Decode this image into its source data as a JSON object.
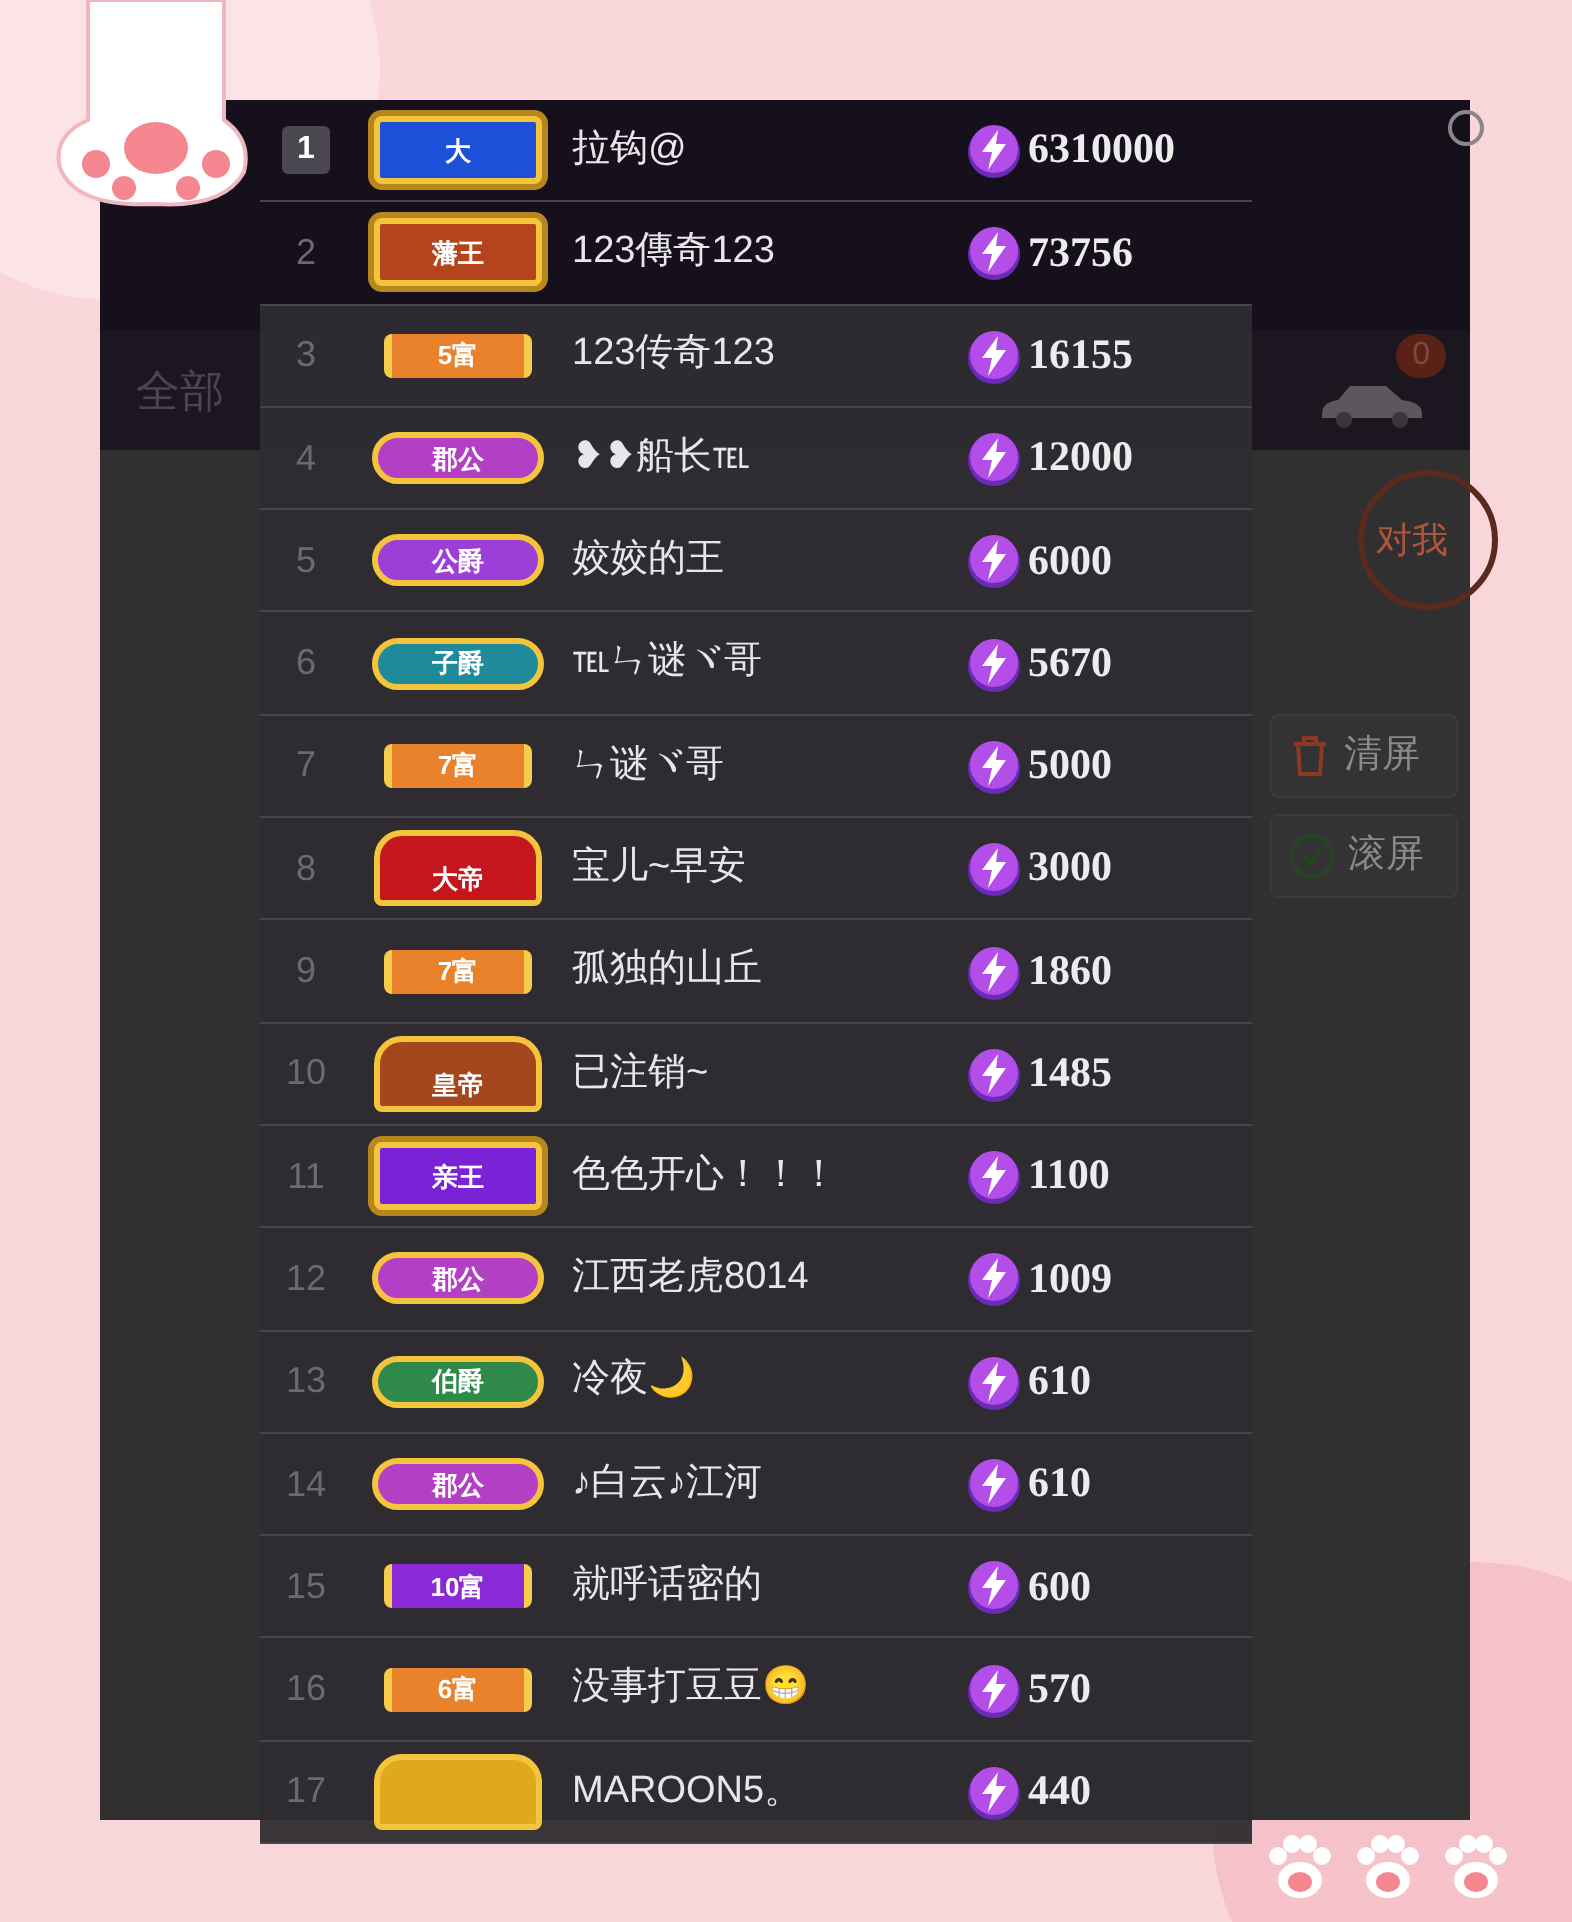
{
  "tabs": [
    {
      "label": "全部"
    }
  ],
  "car_badge": "0",
  "side_bubble": "对我",
  "side_buttons": [
    {
      "kind": "clear",
      "label": "清屏"
    },
    {
      "kind": "scroll",
      "label": "滚屏"
    }
  ],
  "ranking": [
    {
      "rank": "1",
      "boxed": true,
      "badge": {
        "kind": "wing",
        "label": "大",
        "color": "#1d4fd8"
      },
      "name": "拉钩@",
      "score": "6310000"
    },
    {
      "rank": "2",
      "boxed": false,
      "badge": {
        "kind": "wing",
        "label": "藩王",
        "color": "#b5441c"
      },
      "name": "123傳奇123",
      "score": "73756"
    },
    {
      "rank": "3",
      "boxed": false,
      "badge": {
        "kind": "bar",
        "label": "5富",
        "color": "#e9822a"
      },
      "name": "123传奇123",
      "score": "16155"
    },
    {
      "rank": "4",
      "boxed": false,
      "badge": {
        "kind": "hex",
        "label": "郡公",
        "color": "#b23fc4"
      },
      "name": "❥❥船长℡",
      "score": "12000"
    },
    {
      "rank": "5",
      "boxed": false,
      "badge": {
        "kind": "hex",
        "label": "公爵",
        "color": "#9b3fd8"
      },
      "name": "姣姣的王",
      "score": "6000"
    },
    {
      "rank": "6",
      "boxed": false,
      "badge": {
        "kind": "hex",
        "label": "子爵",
        "color": "#1f8a99"
      },
      "name": "℡ㄣ谜ヾ哥",
      "score": "5670"
    },
    {
      "rank": "7",
      "boxed": false,
      "badge": {
        "kind": "bar",
        "label": "7富",
        "color": "#e9822a"
      },
      "name": "ㄣ谜ヾ哥",
      "score": "5000"
    },
    {
      "rank": "8",
      "boxed": false,
      "badge": {
        "kind": "crown",
        "label": "大帝",
        "color": "#c4161c"
      },
      "name": "宝儿~早安",
      "score": "3000"
    },
    {
      "rank": "9",
      "boxed": false,
      "badge": {
        "kind": "bar",
        "label": "7富",
        "color": "#e9822a"
      },
      "name": "孤独的山丘",
      "score": "1860"
    },
    {
      "rank": "10",
      "boxed": false,
      "badge": {
        "kind": "crown",
        "label": "皇帝",
        "color": "#a4461e"
      },
      "name": "已注销~",
      "score": "1485"
    },
    {
      "rank": "11",
      "boxed": false,
      "badge": {
        "kind": "wing",
        "label": "亲王",
        "color": "#7a23d6"
      },
      "name": "色色开心！！！",
      "score": "1100"
    },
    {
      "rank": "12",
      "boxed": false,
      "badge": {
        "kind": "hex",
        "label": "郡公",
        "color": "#b23fc4"
      },
      "name": "江西老虎8014",
      "score": "1009"
    },
    {
      "rank": "13",
      "boxed": false,
      "badge": {
        "kind": "hex",
        "label": "伯爵",
        "color": "#2f8a4a"
      },
      "name": "冷夜🌙",
      "score": "610"
    },
    {
      "rank": "14",
      "boxed": false,
      "badge": {
        "kind": "hex",
        "label": "郡公",
        "color": "#b23fc4"
      },
      "name": "♪白云♪江河",
      "score": "610"
    },
    {
      "rank": "15",
      "boxed": false,
      "badge": {
        "kind": "bar",
        "label": "10富",
        "color": "#8a2ad6"
      },
      "name": "就呼话密的",
      "score": "600"
    },
    {
      "rank": "16",
      "boxed": false,
      "badge": {
        "kind": "bar",
        "label": "6富",
        "color": "#e9822a"
      },
      "name": "没事打豆豆😁",
      "score": "570"
    },
    {
      "rank": "17",
      "boxed": false,
      "badge": {
        "kind": "crown",
        "color": "#e0a91c"
      },
      "name": "MAROON5。",
      "score": "440"
    }
  ]
}
